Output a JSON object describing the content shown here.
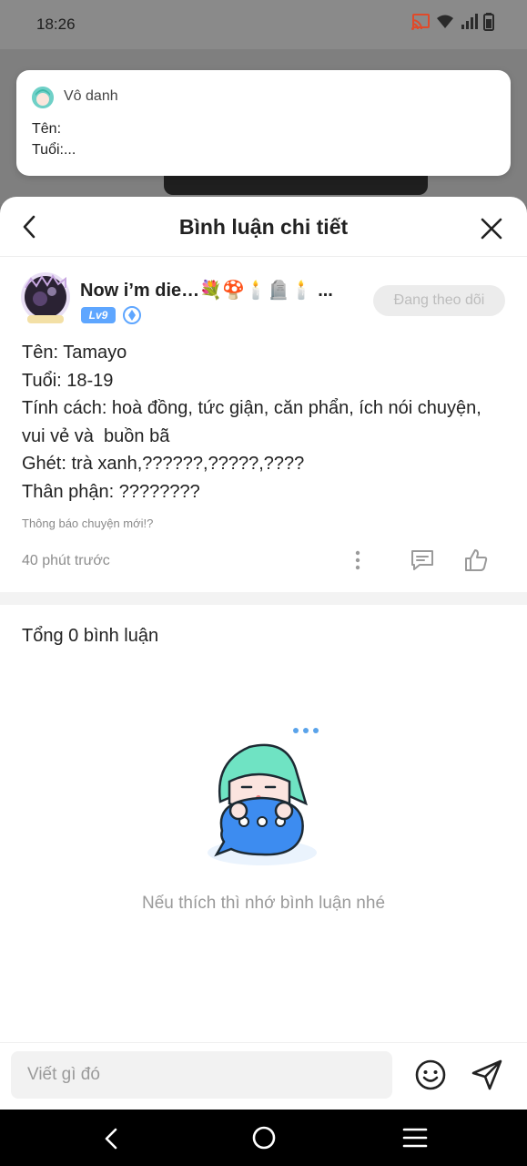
{
  "status_bar": {
    "time": "18:26",
    "icons": [
      "cast-icon",
      "wifi-icon",
      "signal-icon",
      "battery-icon"
    ]
  },
  "notification": {
    "sender": "Vô danh",
    "line1": "Tên:",
    "line2": "Tuổi:..."
  },
  "sheet": {
    "title": "Bình luận chi tiết"
  },
  "post": {
    "author_name": "Now i’m die…💐🍄🕯️🪦🕯️ ...",
    "level": "Lv9",
    "follow_label": "Đang theo dõi",
    "lines": [
      "Tên: Tamayo",
      "Tuổi: 18-19",
      "Tính cách: hoà đồng, tức giận, căn phẩn, ích nói chuyện,",
      "vui vẻ và  buồn bã",
      "Ghét: trà xanh,??????,?????,????",
      "Thân phận: ????????"
    ],
    "note": "Thông báo chuyện mới!?",
    "time": "40 phút trước"
  },
  "comments": {
    "total_label": "Tổng 0 bình luận",
    "empty_text": "Nếu thích thì nhớ bình luận nhé"
  },
  "input": {
    "placeholder": "Viết gì đó"
  },
  "colors": {
    "accent": "#5ea6ff",
    "follow_bg": "#ececec",
    "follow_text": "#bdbdbd",
    "mascot_hair": "#6fe3c3",
    "mascot_bubble": "#3d8cf0"
  }
}
